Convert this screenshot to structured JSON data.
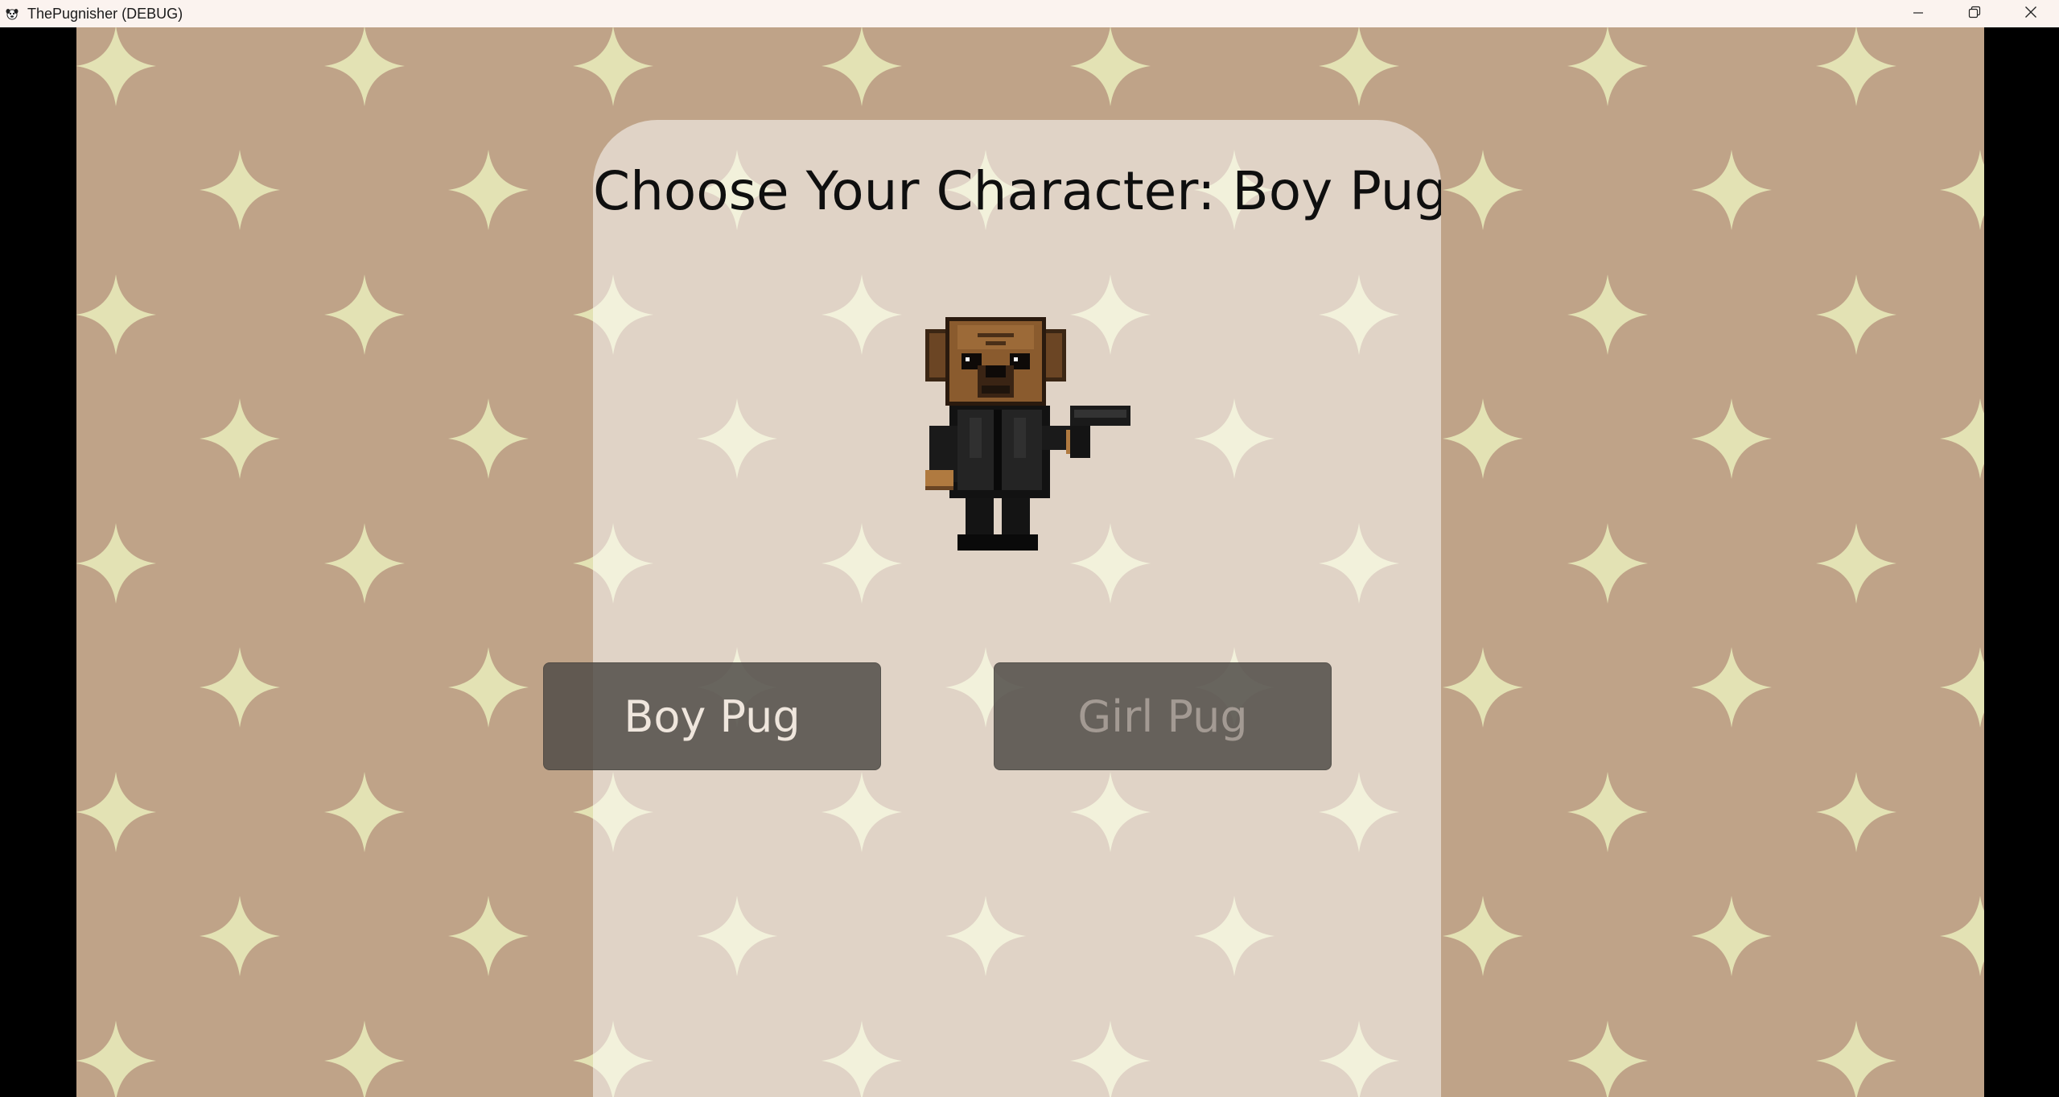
{
  "window": {
    "title": "ThePugnisher (DEBUG)",
    "app_icon": "pug-face-icon",
    "controls": [
      "minimize-icon",
      "restore-icon",
      "close-icon"
    ]
  },
  "screen": {
    "heading": "Choose Your Character: Boy Pug",
    "selected_character": "Boy Pug",
    "character_sprite": "pug-with-pistol-sprite",
    "buttons": {
      "boy": "Boy Pug",
      "girl": "Girl Pug"
    }
  },
  "colors": {
    "background": "#bfa388",
    "sparkle": "#e3e2b4",
    "panel_overlay": "#e0d3c6",
    "button": "#5e5955",
    "button_text_active": "#efe6dd",
    "button_text_inactive": "#a39a93"
  }
}
